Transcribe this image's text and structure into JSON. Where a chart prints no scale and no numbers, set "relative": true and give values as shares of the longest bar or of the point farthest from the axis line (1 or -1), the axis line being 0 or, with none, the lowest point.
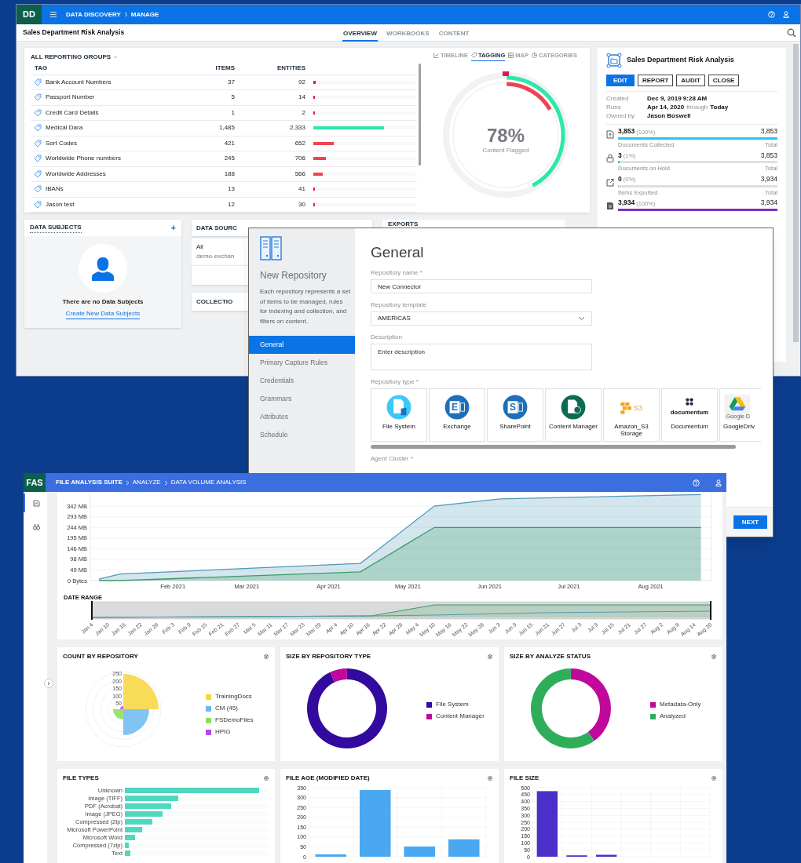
{
  "dd_window": {
    "logo": "DD",
    "breadcrumb": [
      "DATA DISCOVERY",
      "MANAGE"
    ],
    "title": "Sales Department Risk Analysis",
    "tabs": [
      {
        "label": "OVERVIEW",
        "selected": true
      },
      {
        "label": "WORKBOOKS",
        "selected": false
      },
      {
        "label": "CONTENT",
        "selected": false
      }
    ],
    "tag_table": {
      "group": "ALL REPORTING GROUPS",
      "columns": [
        "TAG",
        "ITEMS",
        "ENTITIES"
      ],
      "rows": [
        {
          "tag": "Bank Account Numbers",
          "items": "37",
          "entities": "92",
          "level": 0.025,
          "color": "#e0175a"
        },
        {
          "tag": "Passport Number",
          "items": "5",
          "entities": "14",
          "level": 0.012,
          "color": "#e0175a"
        },
        {
          "tag": "Credit Card Details",
          "items": "1",
          "entities": "2",
          "level": 0.012,
          "color": "#e0175a"
        },
        {
          "tag": "Medical Dara",
          "items": "1,485",
          "entities": "2,333",
          "level": 0.69,
          "color": "#2de8a8"
        },
        {
          "tag": "Sort Codes",
          "items": "421",
          "entities": "652",
          "level": 0.2,
          "color": "#f0424f"
        },
        {
          "tag": "Worldwide Phone numbers",
          "items": "245",
          "entities": "706",
          "level": 0.12,
          "color": "#f0424f"
        },
        {
          "tag": "Worldwide Addresses",
          "items": "188",
          "entities": "566",
          "level": 0.09,
          "color": "#f0424f"
        },
        {
          "tag": "IBANs",
          "items": "13",
          "entities": "41",
          "level": 0.012,
          "color": "#e0175a"
        },
        {
          "tag": "Jason test",
          "items": "12",
          "entities": "30",
          "level": 0.012,
          "color": "#e0175a"
        }
      ]
    },
    "view_tabs": [
      {
        "kind": "timeline",
        "label": "TIMELINE",
        "selected": false
      },
      {
        "kind": "tagging",
        "label": "TAGGING",
        "selected": true
      },
      {
        "kind": "map",
        "label": "MAP",
        "selected": false
      },
      {
        "kind": "categories",
        "label": "CATEGORIES",
        "selected": false
      }
    ],
    "flagged": {
      "percent": "78%",
      "caption": "Content Flagged"
    },
    "summary": {
      "title": "Sales Department Risk Analysis",
      "buttons": [
        {
          "label": "EDIT",
          "primary": true
        },
        {
          "label": "REPORT",
          "primary": false
        },
        {
          "label": "AUDIT",
          "primary": false
        },
        {
          "label": "CLOSE",
          "primary": false
        }
      ],
      "created": {
        "label": "Created",
        "value": "Dec 9, 2019 9:28 AM"
      },
      "runs": {
        "label": "Runs",
        "start": "Apr 14, 2020",
        "joiner": "through",
        "end": "Today"
      },
      "owner": {
        "label": "Owned by",
        "value": "Jason Boswell"
      },
      "stats": [
        {
          "kind": "collected",
          "count": "3,853",
          "percent": "(100%)",
          "total": "3,853",
          "caption": "Documents Collected",
          "total_label": "Total",
          "level": 1,
          "color": "#27c5f7"
        },
        {
          "kind": "hold",
          "count": "3",
          "percent": "(1%)",
          "total": "3,853",
          "caption": "Documents on Hold",
          "total_label": "Total",
          "level": 0.01,
          "color": "#27c5c0"
        },
        {
          "kind": "exported",
          "count": "0",
          "percent": "(0%)",
          "total": "3,934",
          "caption": "Items Exported",
          "total_label": "Total",
          "level": 0
        },
        {
          "kind": "enriched",
          "count": "3,934",
          "percent": "(100%)",
          "total": "3,934",
          "level": 1,
          "color": "#7b2fbf"
        }
      ]
    },
    "data_subjects": {
      "title": "DATA SUBJECTS",
      "add": "+",
      "empty": "There are no Data Subjects",
      "link": "Create New Data Subjects"
    },
    "data_sources": {
      "title": "DATA SOURC",
      "item": "All",
      "item_detail": "demo-exchan"
    },
    "collections": {
      "title": "COLLECTIO"
    },
    "exports": {
      "title": "EXPORTS"
    }
  },
  "repo_dialog": {
    "title": "New Repository",
    "description": "Each repository represents a set of items to be managed, rules for indexing and collection, and filters on content.",
    "nav": [
      {
        "label": "General",
        "selected": true
      },
      {
        "label": "Primary Capture Rules",
        "selected": false
      },
      {
        "label": "Credentials",
        "selected": false
      },
      {
        "label": "Grammars",
        "selected": false
      },
      {
        "label": "Attributes",
        "selected": false
      },
      {
        "label": "Schedule",
        "selected": false
      }
    ],
    "heading": "General",
    "fields": [
      {
        "kind": "text",
        "label": "Repository name *",
        "value": "New Connector"
      },
      {
        "kind": "select",
        "label": "Repository template",
        "value": "AMERICAS"
      },
      {
        "kind": "textarea",
        "label": "Description",
        "placeholder": "Enter description"
      }
    ],
    "type_label": "Repository type *",
    "types": [
      {
        "kind": "filesystem",
        "label": "File System"
      },
      {
        "kind": "exchange",
        "label": "Exchange",
        "logo_text": "E"
      },
      {
        "kind": "sharepoint",
        "label": "SharePoint",
        "logo_text": "S"
      },
      {
        "kind": "contentmanager",
        "label": "Content Manager"
      },
      {
        "kind": "s3",
        "label": "Amazon_S3 Storage",
        "logo_text": "S3"
      },
      {
        "kind": "documentum",
        "label": "Documentum",
        "logo_text": "documentum"
      },
      {
        "kind": "gdrive",
        "label": "GoogleDriv",
        "logo_text": "Google D"
      }
    ],
    "agent_label": "Agent Cluster *",
    "next": "NEXT"
  },
  "fas_window": {
    "logo": "FAS",
    "breadcrumb": [
      "FILE ANALYSIS SUITE",
      "ANALYZE",
      "DATA VOLUME ANALYSIS"
    ],
    "nav": [
      {
        "kind": "reports",
        "selected": true
      },
      {
        "kind": "binoculars",
        "selected": false
      }
    ],
    "volume_chart": {
      "chart_data": {
        "type": "area",
        "x": [
          "2021-01-04",
          "2021-01-12",
          "2021-04-13",
          "2021-05-11",
          "2021-06-05",
          "2021-08-20"
        ],
        "series": [
          {
            "color": "#4e9ab8",
            "values": [
              7,
              30,
              79,
              342,
              375,
              395
            ]
          },
          {
            "color": "#3d9a68",
            "values": [
              0,
              0,
              40,
              244,
              244,
              244
            ]
          }
        ],
        "xlim": [
          "2021-01-01",
          "2021-08-24"
        ],
        "ylim": [
          0,
          400
        ],
        "xticks": [
          {
            "value": "2021-02-01",
            "label": "Feb 2021"
          },
          {
            "value": "2021-03-01",
            "label": "Mar 2021"
          },
          {
            "value": "2021-04-01",
            "label": "Apr 2021"
          },
          {
            "value": "2021-05-01",
            "label": "May 2021"
          },
          {
            "value": "2021-06-01",
            "label": "Jun 2021"
          },
          {
            "value": "2021-07-01",
            "label": "Jul 2021"
          },
          {
            "value": "2021-08-01",
            "label": "Aug 2021"
          }
        ],
        "yticks": [
          {
            "value": 0,
            "label": "0  Bytes"
          },
          {
            "value": 49,
            "label": "49 MB"
          },
          {
            "value": 98,
            "label": "98 MB"
          },
          {
            "value": 146,
            "label": "146 MB"
          },
          {
            "value": 195,
            "label": "195 MB"
          },
          {
            "value": 244,
            "label": "244 MB"
          },
          {
            "value": 293,
            "label": "293 MB"
          },
          {
            "value": 342,
            "label": "342 MB"
          }
        ],
        "grid": true
      }
    },
    "date_range": {
      "label": "DATE RANGE",
      "ticks": [
        "Jan 4",
        "Jan 10",
        "Jan 16",
        "Jan 22",
        "Jan 28",
        "Feb 3",
        "Feb 9",
        "Feb 15",
        "Feb 21",
        "Feb 27",
        "Mar 5",
        "Mar 11",
        "Mar 17",
        "Mar 23",
        "Mar 29",
        "Apr 4",
        "Apr 10",
        "Apr 16",
        "Apr 22",
        "Apr 28",
        "May 4",
        "May 10",
        "May 16",
        "May 22",
        "May 28",
        "Jun 3",
        "Jun 9",
        "Jun 15",
        "Jun 21",
        "Jun 27",
        "Jul 3",
        "Jul 9",
        "Jul 15",
        "Jul 21",
        "Jul 27",
        "Aug 2",
        "Aug 8",
        "Aug 14",
        "Aug 20"
      ]
    },
    "cards": [
      {
        "kind": "polar",
        "title": "COUNT BY REPOSITORY",
        "axis_labels": [
          "250",
          "200",
          "150",
          "100",
          "50"
        ],
        "legend": [
          {
            "label": "TrainingDocs",
            "color": "#f7d53a"
          },
          {
            "label": "CM (45)",
            "color": "#6cb8f5"
          },
          {
            "label": "FSDemoFiles",
            "color": "#8cdc5c"
          },
          {
            "label": "HPIG",
            "color": "#b44be0"
          }
        ]
      },
      {
        "kind": "donut",
        "title": "SIZE BY REPOSITORY TYPE",
        "chart_data": {
          "type": "donut",
          "relative": true,
          "categories": [
            "File System",
            "Content Manager"
          ],
          "values": [
            93,
            7
          ]
        },
        "legend": [
          {
            "color": "#320a9e"
          },
          {
            "color": "#c0089c"
          }
        ]
      },
      {
        "kind": "donut",
        "title": "SIZE BY ANALYZE STATUS",
        "chart_data": {
          "type": "donut",
          "relative": true,
          "categories": [
            "Metadata-Only",
            "Analyzed"
          ],
          "values": [
            40,
            60
          ]
        },
        "legend": [
          {
            "color": "#c0089c"
          },
          {
            "color": "#2fae5a"
          }
        ]
      },
      {
        "kind": "barlist",
        "title": "FILE TYPES",
        "rows": [
          {
            "label": "Unknown",
            "level": 0.93
          },
          {
            "label": "Image (TIFF)",
            "level": 0.37
          },
          {
            "label": "PDF (Acrobat)",
            "level": 0.32
          },
          {
            "label": "Image (JPEG)",
            "level": 0.26
          },
          {
            "label": "Compressed (Zip)",
            "level": 0.19
          },
          {
            "label": "Microsoft PowerPoint",
            "level": 0.12
          },
          {
            "label": "Microsoft Word",
            "level": 0.07
          },
          {
            "label": "Compressed (7zip)",
            "level": 0.025
          },
          {
            "label": "Text",
            "level": 0.037
          }
        ]
      },
      {
        "kind": "bar",
        "title": "FILE AGE (MODIFIED DATE)",
        "chart_data": {
          "type": "bar",
          "orientation": "vertical",
          "grid": true,
          "series": [
            {
              "color": "#4aa8f0",
              "values": [
                12,
                338,
                52,
                88
              ]
            }
          ],
          "ylim": [
            0,
            350
          ],
          "yticks": [
            0,
            50,
            100,
            150,
            200,
            250,
            300,
            350
          ]
        }
      },
      {
        "kind": "bar",
        "title": "FILE SIZE",
        "chart_data": {
          "type": "bar",
          "orientation": "vertical",
          "grid": true,
          "series": [
            {
              "color": "#4b2fc8",
              "values": [
                475,
                10,
                14,
                0,
                0,
                0
              ]
            }
          ],
          "ylim": [
            0,
            500
          ],
          "yticks": [
            0,
            50,
            100,
            150,
            200,
            250,
            300,
            350,
            400,
            450,
            500
          ]
        }
      }
    ]
  }
}
